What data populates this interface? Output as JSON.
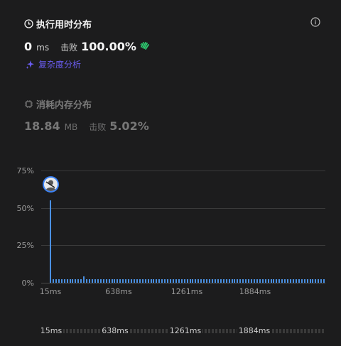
{
  "runtime": {
    "title": "执行用时分布",
    "value": "0",
    "unit": "ms",
    "beat_label": "击败",
    "beat_value": "100.00%",
    "complexity_link": "复杂度分析"
  },
  "memory": {
    "title": "消耗内存分布",
    "value": "18.84",
    "unit": "MB",
    "beat_label": "击败",
    "beat_value": "5.02%"
  },
  "colors": {
    "bar": "#4a90e2",
    "accent": "#6a5cf0",
    "success": "#2ecc71"
  },
  "chart_data": {
    "type": "bar",
    "y_ticks": [
      "75%",
      "50%",
      "25%",
      "0%"
    ],
    "x_ticks": [
      "15ms",
      "638ms",
      "1261ms",
      "1884ms"
    ],
    "ylim": [
      0,
      75
    ],
    "values": [
      55,
      2.5,
      2.5,
      2.5,
      2.5,
      2.5,
      2.5,
      2.5,
      2.5,
      2.5,
      2.5,
      2.5,
      4.3,
      2.5,
      2.5,
      2.5,
      2.5,
      2.5,
      2.5,
      2.5,
      2.5,
      2.5,
      2.5,
      2.5,
      2.5,
      2.5,
      2.5,
      2.5,
      2.5,
      2.5,
      2.5,
      2.5,
      2.5,
      2.5,
      2.5,
      2.5,
      2.5,
      2.5,
      2.5,
      2.5,
      2.5,
      2.5,
      2.5,
      2.5,
      2.5,
      2.5,
      2.5,
      2.5,
      2.5,
      2.5,
      2.5,
      2.5,
      2.5,
      2.5,
      2.5,
      2.5,
      2.5,
      2.5,
      2.5,
      2.5,
      2.5,
      2.5,
      2.5,
      2.5,
      2.5,
      2.5,
      2.5,
      2.5,
      2.5,
      2.5,
      2.5,
      2.5,
      2.5,
      2.5,
      2.5,
      2.5,
      2.5,
      2.5,
      2.5,
      2.5,
      2.5,
      2.5,
      2.5,
      2.5,
      2.5,
      2.5,
      2.5,
      2.5,
      2.5,
      2.5,
      2.5,
      2.5,
      2.5,
      2.5,
      2.5,
      2.5,
      2.5,
      2.5,
      2.5
    ]
  },
  "scroller": {
    "labels": [
      "15ms",
      "638ms",
      "1261ms",
      "1884ms"
    ]
  }
}
